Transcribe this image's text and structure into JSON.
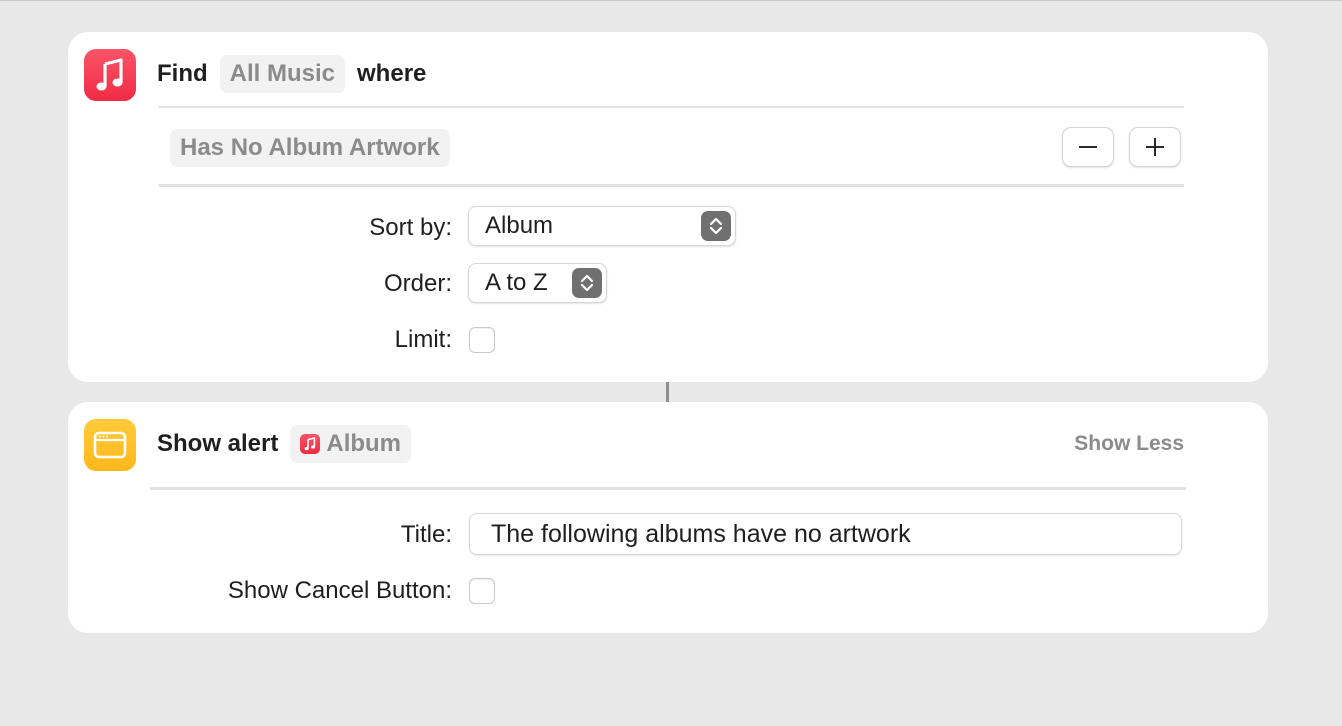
{
  "find_action": {
    "verb": "Find",
    "source": "All Music",
    "connector": "where",
    "filter": "Has No Album Artwork",
    "remove_filter_symbol": "−",
    "add_filter_symbol": "+",
    "sort_by_label": "Sort by:",
    "sort_by_value": "Album",
    "order_label": "Order:",
    "order_value": "A to Z",
    "limit_label": "Limit:",
    "limit_checked": false
  },
  "alert_action": {
    "verb": "Show alert",
    "variable": "Album",
    "toggle_link": "Show Less",
    "title_label": "Title:",
    "title_value": "The following albums have no artwork",
    "cancel_label": "Show Cancel Button:",
    "cancel_checked": false
  },
  "icons": {
    "music_app": "music-note-icon",
    "alert_app": "window-icon"
  },
  "colors": {
    "music_red": "#f02b44",
    "alert_yellow": "#ffb81c",
    "background": "#e8e8e8",
    "placeholder_gray": "#8b8b8b"
  }
}
